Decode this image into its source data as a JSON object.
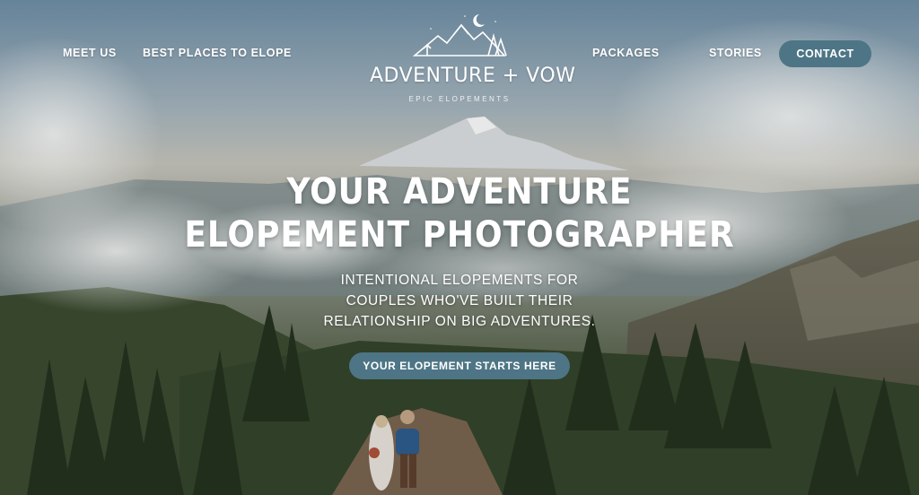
{
  "nav": {
    "left": [
      {
        "label": "MEET US"
      },
      {
        "label": "BEST PLACES TO ELOPE"
      }
    ],
    "right": [
      {
        "label": "PACKAGES"
      },
      {
        "label": "STORIES"
      }
    ],
    "contact_label": "CONTACT"
  },
  "logo": {
    "wordmark": "ADVENTURE + VOW",
    "tagline": "EPIC ELOPEMENTS"
  },
  "hero": {
    "headline_line1": "YOUR ADVENTURE",
    "headline_line2": "ELOPEMENT PHOTOGRAPHER",
    "subhead_lines": [
      "INTENTIONAL ELOPEMENTS FOR",
      "COUPLES WHO'VE BUILT THEIR",
      "RELATIONSHIP ON BIG ADVENTURES."
    ],
    "cta_label": "YOUR ELOPEMENT STARTS HERE"
  },
  "colors": {
    "accent": "#4d7585",
    "text": "#ffffff"
  },
  "icons": [
    "crescent-moon-icon",
    "mountain-logo-icon"
  ]
}
